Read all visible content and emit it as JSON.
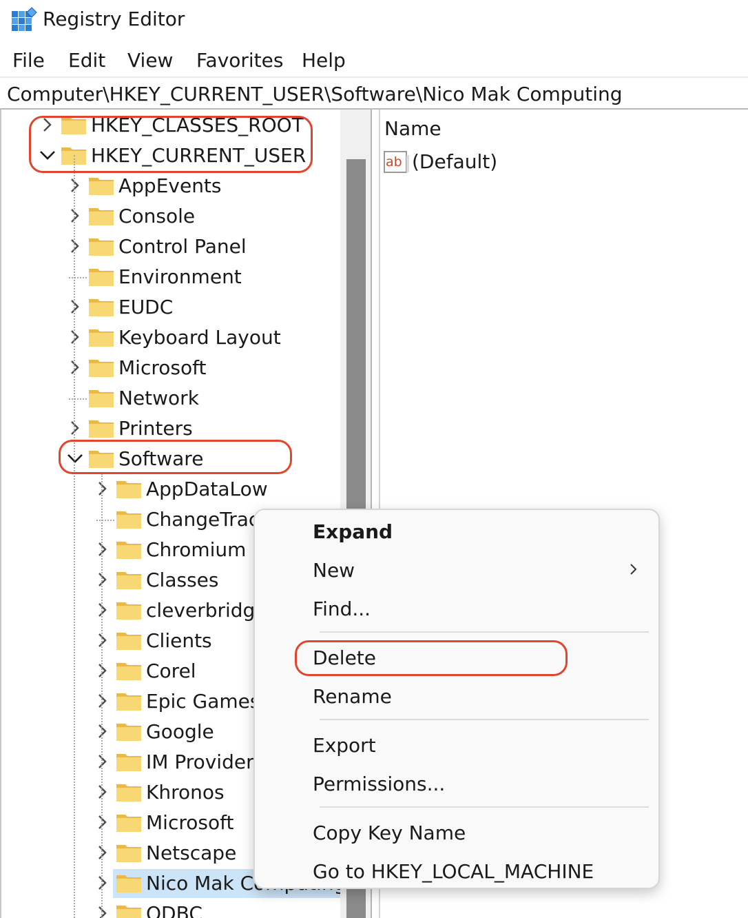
{
  "window": {
    "title": "Registry Editor",
    "app_icon": "registry-editor-icon"
  },
  "menu": [
    "File",
    "Edit",
    "View",
    "Favorites",
    "Help"
  ],
  "address": "Computer\\HKEY_CURRENT_USER\\Software\\Nico Mak Computing",
  "tree": [
    {
      "label": "HKEY_CLASSES_ROOT",
      "level": 0,
      "expander": "collapsed"
    },
    {
      "label": "HKEY_CURRENT_USER",
      "level": 0,
      "expander": "expanded"
    },
    {
      "label": "AppEvents",
      "level": 1,
      "expander": "collapsed"
    },
    {
      "label": "Console",
      "level": 1,
      "expander": "collapsed"
    },
    {
      "label": "Control Panel",
      "level": 1,
      "expander": "collapsed"
    },
    {
      "label": "Environment",
      "level": 1,
      "expander": "none"
    },
    {
      "label": "EUDC",
      "level": 1,
      "expander": "collapsed"
    },
    {
      "label": "Keyboard Layout",
      "level": 1,
      "expander": "collapsed"
    },
    {
      "label": "Microsoft",
      "level": 1,
      "expander": "collapsed"
    },
    {
      "label": "Network",
      "level": 1,
      "expander": "none"
    },
    {
      "label": "Printers",
      "level": 1,
      "expander": "collapsed"
    },
    {
      "label": "Software",
      "level": 1,
      "expander": "expanded"
    },
    {
      "label": "AppDataLow",
      "level": 2,
      "expander": "collapsed"
    },
    {
      "label": "ChangeTrac",
      "level": 2,
      "expander": "none"
    },
    {
      "label": "Chromium",
      "level": 2,
      "expander": "collapsed"
    },
    {
      "label": "Classes",
      "level": 2,
      "expander": "collapsed"
    },
    {
      "label": "cleverbridge",
      "level": 2,
      "expander": "collapsed"
    },
    {
      "label": "Clients",
      "level": 2,
      "expander": "collapsed"
    },
    {
      "label": "Corel",
      "level": 2,
      "expander": "collapsed"
    },
    {
      "label": "Epic Games",
      "level": 2,
      "expander": "collapsed"
    },
    {
      "label": "Google",
      "level": 2,
      "expander": "collapsed"
    },
    {
      "label": "IM Providers",
      "level": 2,
      "expander": "collapsed"
    },
    {
      "label": "Khronos",
      "level": 2,
      "expander": "collapsed"
    },
    {
      "label": "Microsoft",
      "level": 2,
      "expander": "collapsed"
    },
    {
      "label": "Netscape",
      "level": 2,
      "expander": "collapsed"
    },
    {
      "label": "Nico Mak Computing",
      "level": 2,
      "expander": "collapsed",
      "selected": true
    },
    {
      "label": "ODBC",
      "level": 2,
      "expander": "collapsed"
    }
  ],
  "values_pane": {
    "column_name": "Name",
    "values": [
      {
        "name": "(Default)",
        "icon": "string-value-icon"
      }
    ]
  },
  "context_menu": {
    "items": [
      {
        "label": "Expand",
        "bold": true
      },
      {
        "label": "New",
        "submenu": true
      },
      {
        "label": "Find..."
      },
      {
        "separator": true
      },
      {
        "label": "Delete",
        "highlighted": true
      },
      {
        "label": "Rename"
      },
      {
        "separator": true
      },
      {
        "label": "Export"
      },
      {
        "label": "Permissions..."
      },
      {
        "separator": true
      },
      {
        "label": "Copy Key Name"
      },
      {
        "label": "Go to HKEY_LOCAL_MACHINE"
      }
    ]
  },
  "annotations": {
    "highlight_color": "#e0452d"
  },
  "colors": {
    "selection": "#cce4f7",
    "folder": "#f8d775",
    "folder_dark": "#e9b94a",
    "scrollbar_thumb": "#8a8a8a"
  }
}
